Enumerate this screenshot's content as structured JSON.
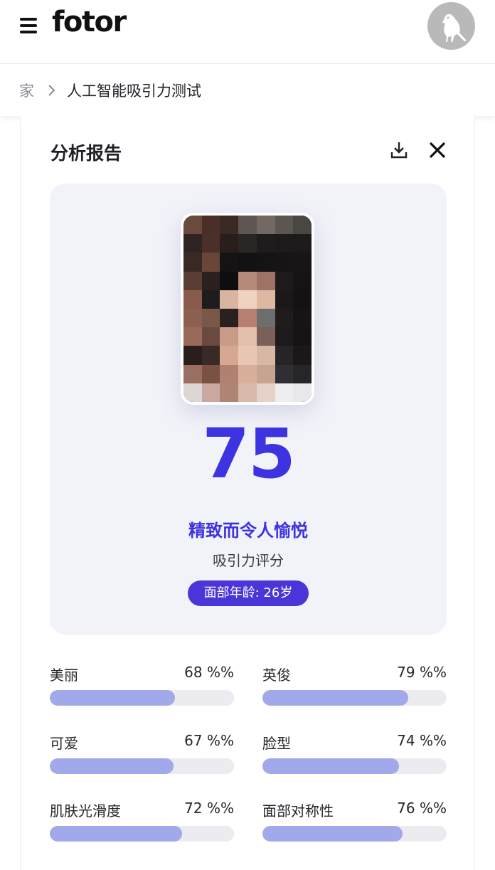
{
  "header": {
    "logo": "fotor"
  },
  "breadcrumb": {
    "home": "家",
    "current": "人工智能吸引力测试"
  },
  "report": {
    "title": "分析报告",
    "score": "75",
    "verdict": "精致而令人愉悦",
    "score_label": "吸引力评分",
    "age_badge": "面部年龄: 26岁",
    "metrics": [
      {
        "name": "美丽",
        "value_text": "68 %%",
        "percent": 68
      },
      {
        "name": "英俊",
        "value_text": "79 %%",
        "percent": 79
      },
      {
        "name": "可爱",
        "value_text": "67 %%",
        "percent": 67
      },
      {
        "name": "脸型",
        "value_text": "74 %%",
        "percent": 74
      },
      {
        "name": "肌肤光滑度",
        "value_text": "72 %%",
        "percent": 72
      },
      {
        "name": "面部对称性",
        "value_text": "76 %%",
        "percent": 76
      }
    ]
  },
  "colors": {
    "accent": "#3d33e0",
    "badge": "#4a35d9",
    "bar_fill": "#a2a9ea",
    "bar_track": "#ececf0"
  },
  "icons": {
    "menu": "hamburger-icon",
    "avatar": "bird-icon",
    "breadcrumb_separator": "chevron-right-icon",
    "download": "download-icon",
    "close": "close-icon"
  }
}
